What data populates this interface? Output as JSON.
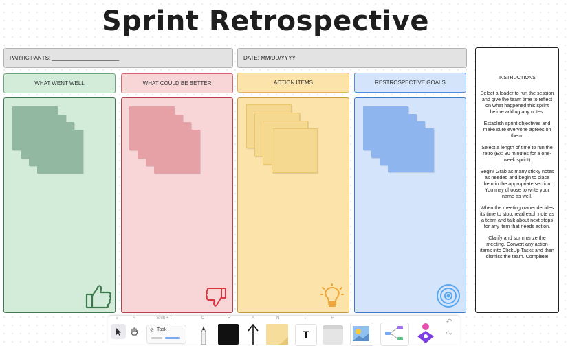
{
  "board": {
    "title": "Sprint Retrospective",
    "participants_label": "PARTICIPANTS: ______________________",
    "date_label": "DATE: MM/DD/YYYY"
  },
  "columns": [
    {
      "label": "WHAT WENT WELL",
      "icon": "thumbs-up-icon",
      "color": "#3f7a4f"
    },
    {
      "label": "WHAT COULD BE BETTER",
      "icon": "thumbs-down-icon",
      "color": "#d9363e"
    },
    {
      "label": "ACTION ITEMS",
      "icon": "lightbulb-icon",
      "color": "#f0a53a"
    },
    {
      "label": "RESTROSPECTIVE GOALS",
      "icon": "target-icon",
      "color": "#5aa8f0"
    }
  ],
  "instructions": {
    "heading": "INSTRUCTIONS",
    "steps": [
      "Select a leader to run the session and give the team time to reflect on what happened this sprint before adding any notes.",
      "Establish sprint objectives and make sure everyone agrees on them.",
      "Select a length of time to run the retro (Ex: 30 minutes for a one-week sprint)",
      "Begin! Grab as many sticky notes as needed and begin to place them in the appropriate section. You may choose to write your name as well.",
      "When the meeting owner decides its time to stop, read each note as a team and talk about next steps for any item that needs action.",
      "Clarify and summarize the meeting. Convert any action items into ClickUp Tasks and then dismiss the team. Complete!"
    ]
  },
  "toolbar": {
    "shortcuts": {
      "select": "V",
      "hand": "H",
      "task": "Shift + T",
      "draw": "D",
      "rect": "R",
      "arrow": "A",
      "note": "N",
      "text": "T",
      "frame": "F"
    },
    "task_label": "Task"
  }
}
